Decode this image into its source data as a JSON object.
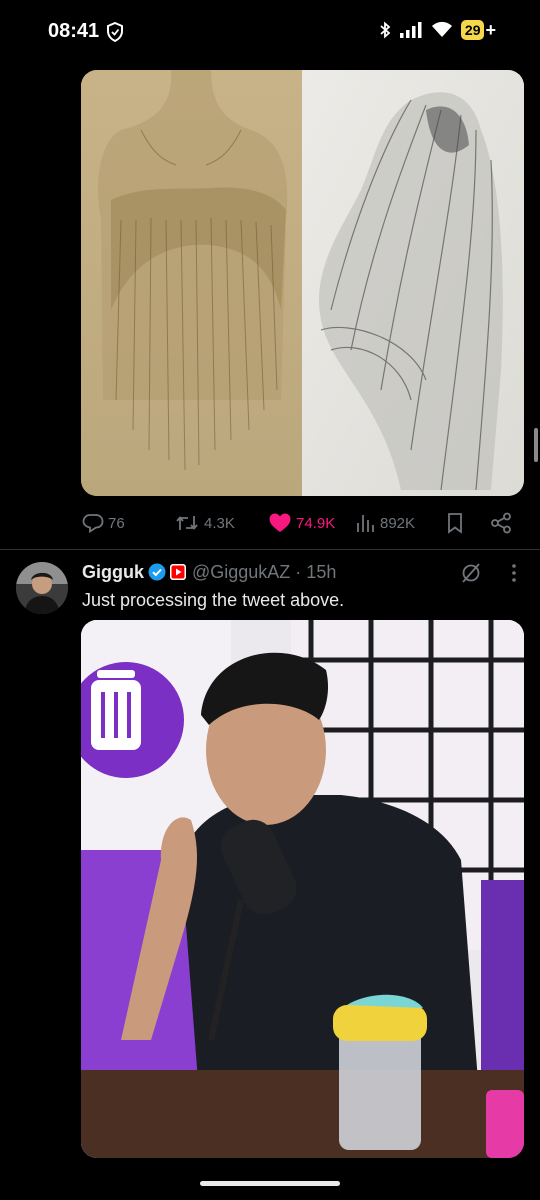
{
  "status_bar": {
    "time": "08:41",
    "battery_level": "29",
    "battery_plus": "+",
    "icons": [
      "shield-icon",
      "bluetooth-icon",
      "signal-icon",
      "wifi-icon",
      "battery-icon"
    ]
  },
  "tweet1": {
    "media_description_icon": "drapery-sketch-image",
    "actions": {
      "replies": "76",
      "reposts": "4.3K",
      "likes": "74.9K",
      "views": "892K"
    },
    "liked": true,
    "colors": {
      "like": "#f91880",
      "muted": "#71767b"
    }
  },
  "tweet2": {
    "display_name": "Gigguk",
    "handle_time": "@GiggukAZ · 15h",
    "text": "Just processing the tweet above.",
    "verified": true,
    "icons": [
      "verified-badge-icon",
      "youtube-badge-icon",
      "grok-icon",
      "more-icon"
    ],
    "colors": {
      "verified": "#1d9bf0",
      "youtube": "#ff0000"
    }
  }
}
